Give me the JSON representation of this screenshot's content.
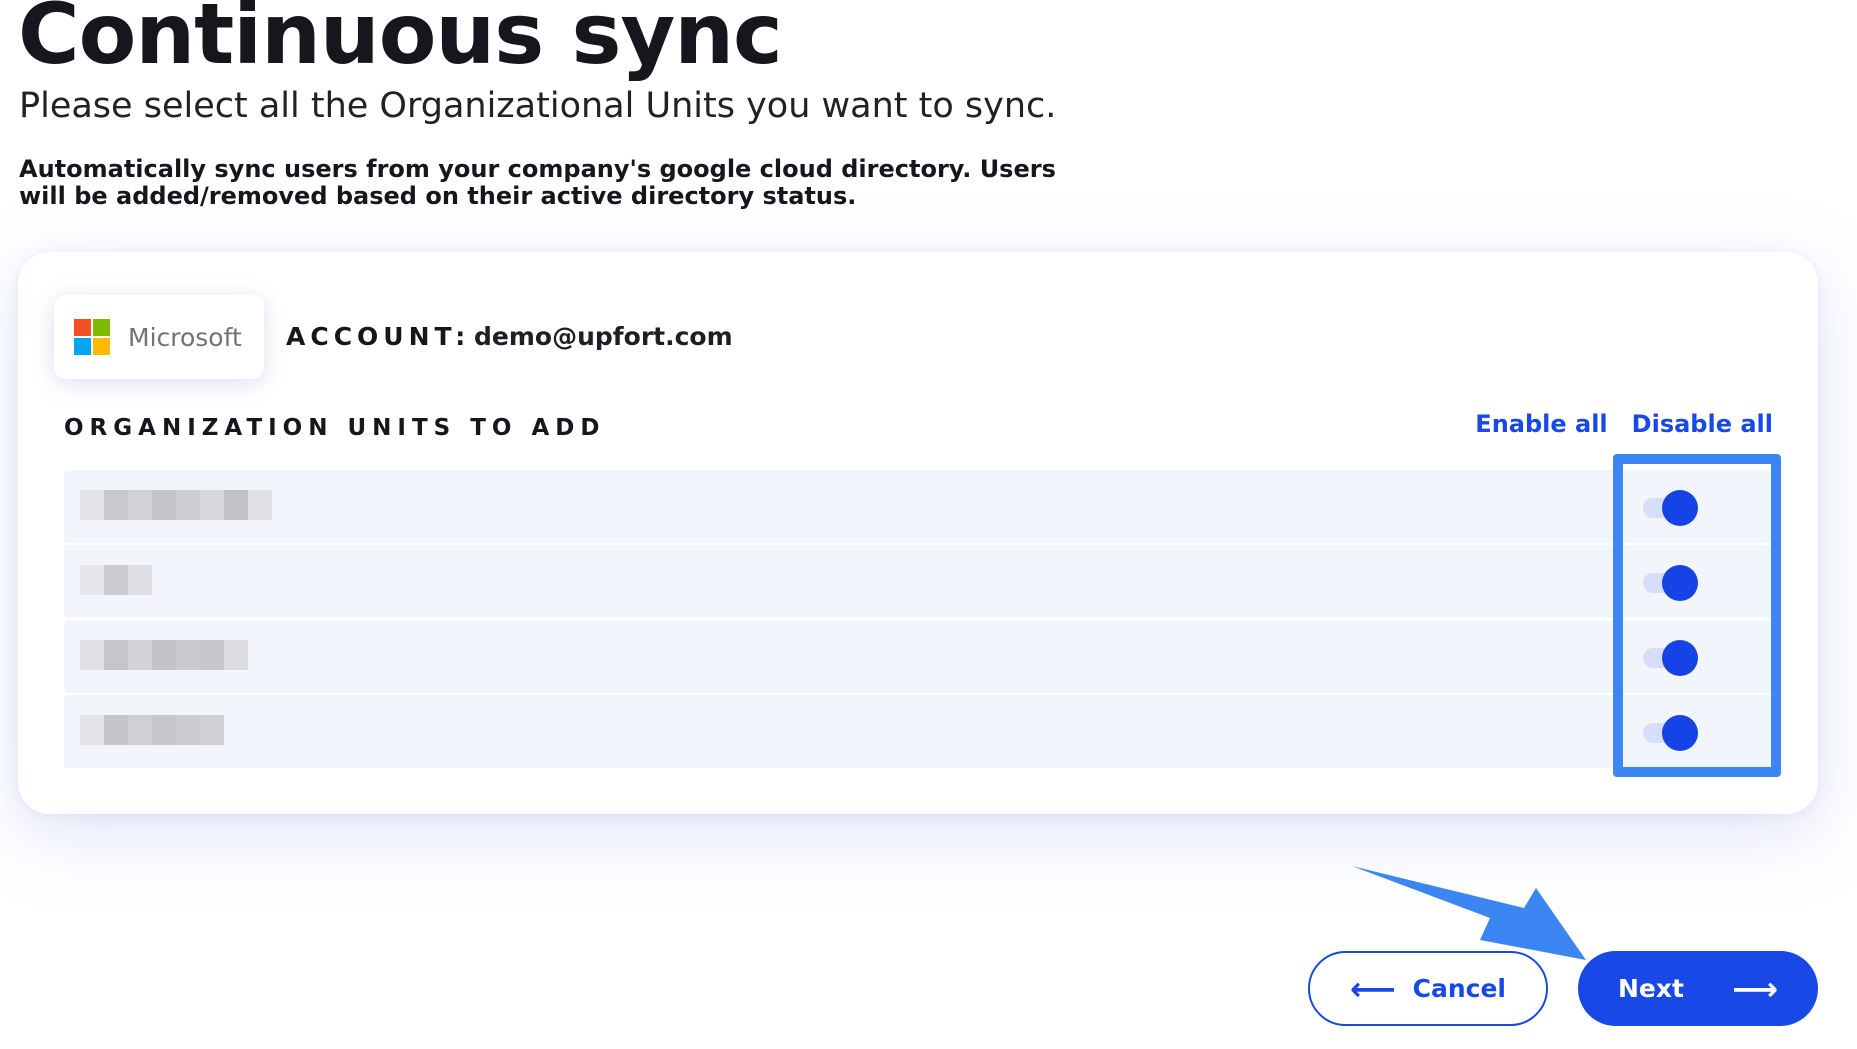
{
  "page": {
    "title": "Continuous sync",
    "subtitle": "Please select all the Organizational Units you want to sync.",
    "description": "Automatically sync users from your company's google cloud directory. Users will be added/removed based on their active directory status."
  },
  "provider": {
    "name": "Microsoft",
    "logo_colors": [
      "#f25022",
      "#7fba00",
      "#00a4ef",
      "#ffb900"
    ]
  },
  "account": {
    "label": "ACCOUNT:",
    "email": "demo@upfort.com"
  },
  "org_units": {
    "heading": "ORGANIZATION UNITS TO ADD",
    "enable_all_label": "Enable all",
    "disable_all_label": "Disable all",
    "items": [
      {
        "name": "",
        "enabled": true
      },
      {
        "name": "",
        "enabled": true
      },
      {
        "name": "",
        "enabled": true
      },
      {
        "name": "",
        "enabled": true
      }
    ]
  },
  "footer": {
    "cancel_label": "Cancel",
    "next_label": "Next",
    "cancel_icon": "arrow-left-icon",
    "next_icon": "arrow-right-icon"
  },
  "colors": {
    "accent": "#1848e6",
    "highlight": "#3b86f2"
  }
}
